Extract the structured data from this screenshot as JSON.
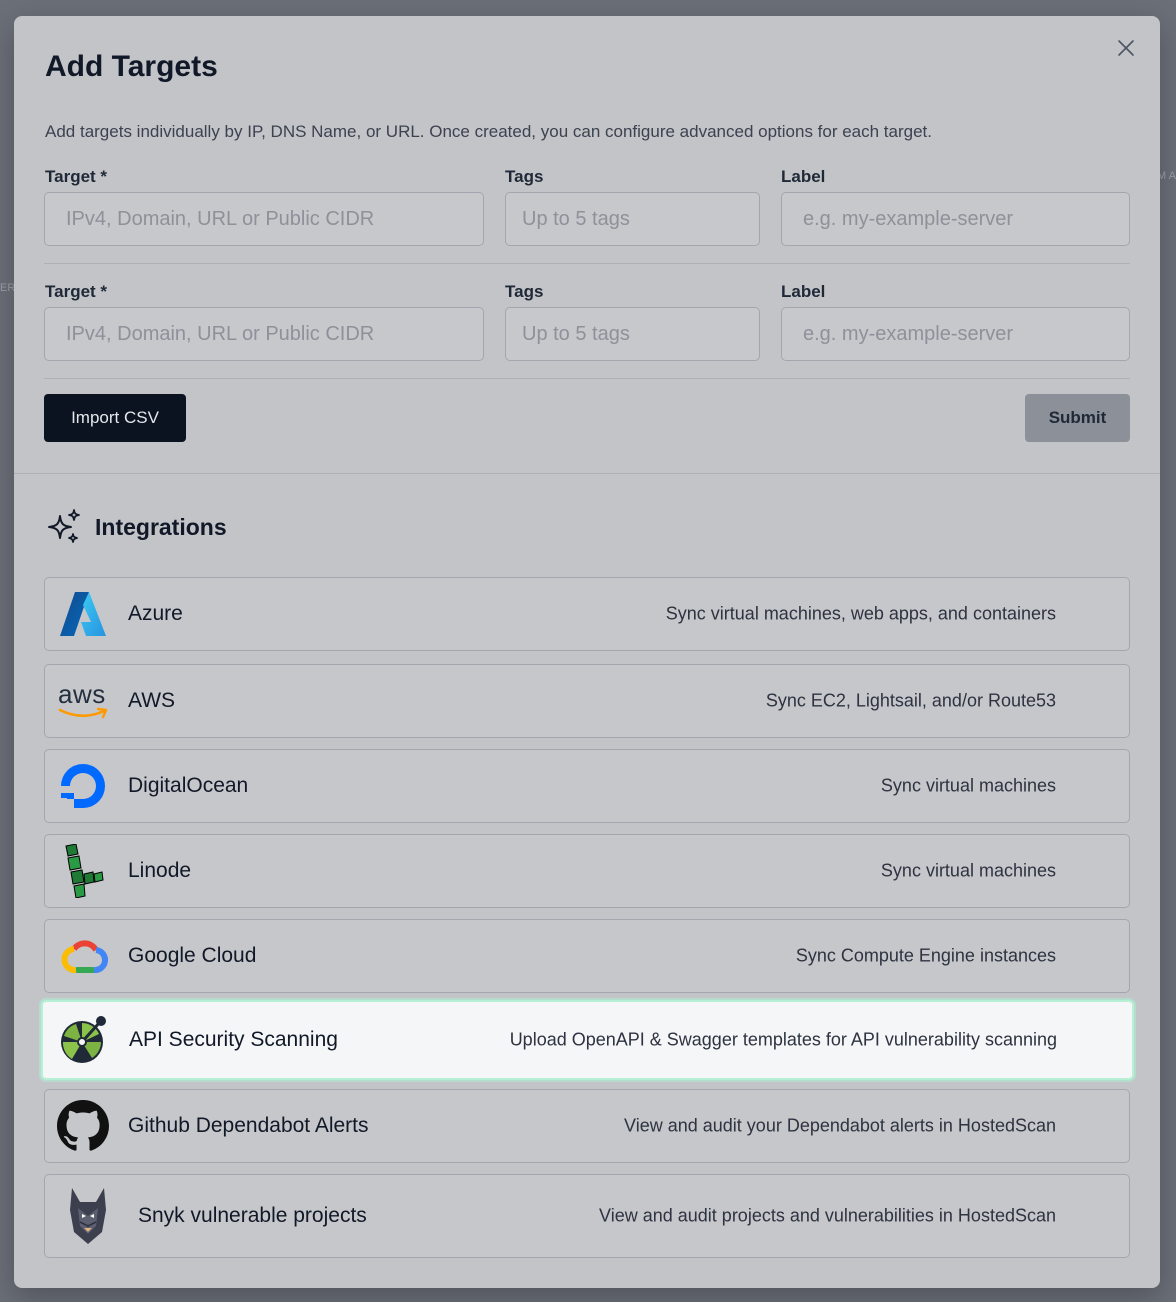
{
  "modal": {
    "title": "Add Targets",
    "description": "Add targets individually by IP, DNS Name, or URL. Once created, you can configure advanced options for each target."
  },
  "rows": [
    {
      "target_label": "Target *",
      "target_placeholder": "IPv4, Domain, URL or Public CIDR",
      "tags_label": "Tags",
      "tags_placeholder": "Up to 5 tags",
      "label_label": "Label",
      "label_placeholder": "e.g. my-example-server"
    },
    {
      "target_label": "Target *",
      "target_placeholder": "IPv4, Domain, URL or Public CIDR",
      "tags_label": "Tags",
      "tags_placeholder": "Up to 5 tags",
      "label_label": "Label",
      "label_placeholder": "e.g. my-example-server"
    }
  ],
  "actions": {
    "import_csv": "Import CSV",
    "submit": "Submit"
  },
  "integrations": {
    "title": "Integrations",
    "icon": "sparkles-icon",
    "items": [
      {
        "name": "Azure",
        "description": "Sync virtual machines, web apps, and containers",
        "icon": "azure-logo"
      },
      {
        "name": "AWS",
        "description": "Sync EC2, Lightsail, and/or Route53",
        "icon": "aws-logo",
        "logo_text": "aws"
      },
      {
        "name": "DigitalOcean",
        "description": "Sync virtual machines",
        "icon": "digitalocean-logo"
      },
      {
        "name": "Linode",
        "description": "Sync virtual machines",
        "icon": "linode-logo"
      },
      {
        "name": "Google Cloud",
        "description": "Sync Compute Engine instances",
        "icon": "google-cloud-logo"
      },
      {
        "name": "API Security Scanning",
        "description": "Upload OpenAPI & Swagger templates for API vulnerability scanning",
        "icon": "api-scan-logo"
      },
      {
        "name": "Github Dependabot Alerts",
        "description": "View and audit your Dependabot alerts in HostedScan",
        "icon": "github-logo"
      },
      {
        "name": "Snyk vulnerable projects",
        "description": "View and audit projects and vulnerabilities in HostedScan",
        "icon": "snyk-logo"
      }
    ]
  },
  "colors": {
    "overlay": "#6b6f78",
    "modal_bg": "#c3c4c8",
    "primary_button": "#0b1220",
    "highlight_border": "#b8f0d6"
  }
}
